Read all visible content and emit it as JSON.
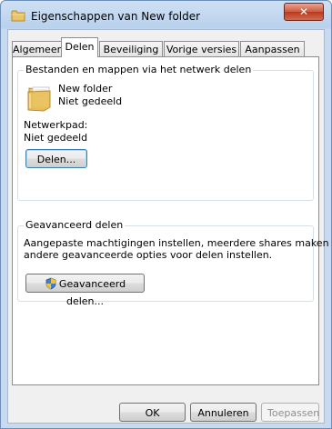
{
  "window": {
    "title": "Eigenschappen van New folder",
    "close_label": "✕"
  },
  "tabs": [
    {
      "label": "Algemeen",
      "active": false
    },
    {
      "label": "Delen",
      "active": true
    },
    {
      "label": "Beveiliging",
      "active": false
    },
    {
      "label": "Vorige versies",
      "active": false
    },
    {
      "label": "Aanpassen",
      "active": false
    }
  ],
  "sharing": {
    "group_title": "Bestanden en mappen via het netwerk delen",
    "folder_name": "New folder",
    "folder_status": "Niet gedeeld",
    "path_label": "Netwerkpad:",
    "path_value": "Niet gedeeld",
    "share_button": "Delen..."
  },
  "advanced": {
    "group_title": "Geavanceerd delen",
    "description_line1": "Aangepaste machtigingen instellen, meerdere shares maken en",
    "description_line2": "andere geavanceerde opties voor delen instellen.",
    "button": "Geavanceerd delen..."
  },
  "footer": {
    "ok": "OK",
    "cancel": "Annuleren",
    "apply": "Toepassen"
  },
  "colors": {
    "title_bar": "#b9d1ec",
    "close_button": "#cf5a3f",
    "folder": "#e9c46a"
  }
}
